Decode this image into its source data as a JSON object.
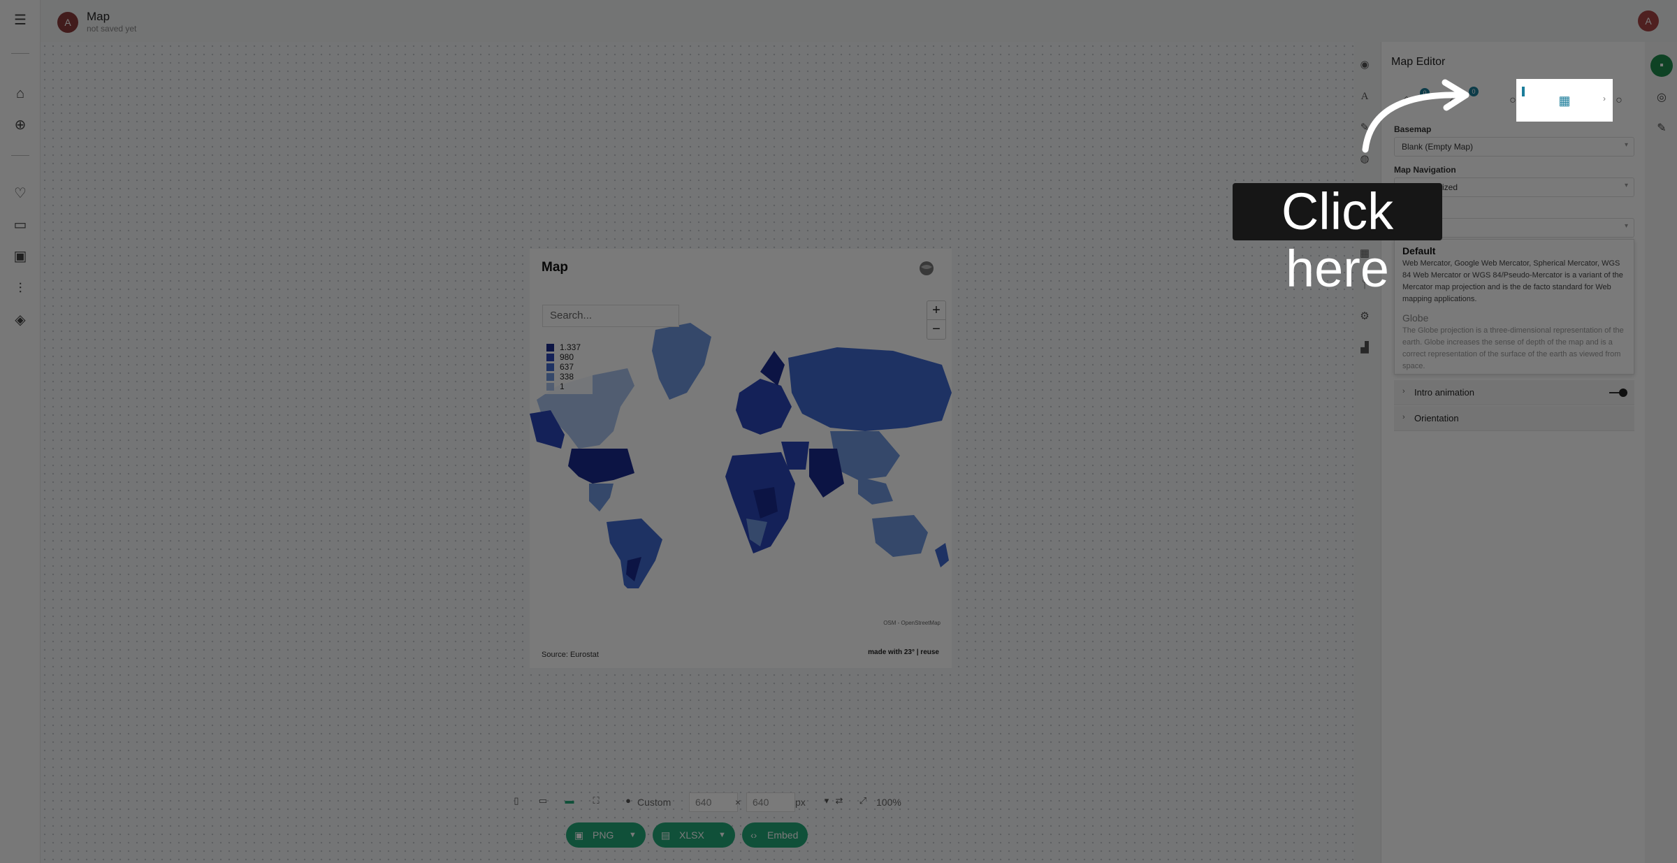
{
  "header": {
    "title": "Map",
    "subtitle": "not saved yet",
    "avatar_initial": "A",
    "right_avatar_initial": "A"
  },
  "leftbar": {
    "items": [
      "menu-icon",
      "home-icon",
      "add-icon",
      "heart-icon",
      "folder-icon",
      "image-icon",
      "sliders-icon",
      "layers-icon"
    ]
  },
  "map_card": {
    "title": "Map",
    "search_placeholder": "Search...",
    "zoom_in": "+",
    "zoom_out": "−",
    "legend": [
      {
        "label": "1.337",
        "color": "#1a2a8e"
      },
      {
        "label": "980",
        "color": "#2a46b8"
      },
      {
        "label": "637",
        "color": "#3f69cf"
      },
      {
        "label": "338",
        "color": "#6f97de"
      },
      {
        "label": "1",
        "color": "#a9c2ec"
      }
    ],
    "attribution": "OSM - OpenStreetMap",
    "source": "Source: Eurostat",
    "made_with": "made with 23° | reuse",
    "logo_text": "23°"
  },
  "bottom_toolbar": {
    "size_preset": "Custom",
    "width_value": "640",
    "height_value": "640",
    "unit": "px",
    "zoom": "100%",
    "separator": "×"
  },
  "export_buttons": [
    {
      "label": "PNG",
      "icon": "image-icon"
    },
    {
      "label": "XLSX",
      "icon": "table-icon"
    },
    {
      "label": "Embed",
      "icon": "code-icon"
    }
  ],
  "editor": {
    "title": "Map Editor",
    "tab_badges": [
      "0",
      "0"
    ],
    "basemap_label": "Basemap",
    "basemap_value": "Blank (Empty Map)",
    "navigation_label": "Map Navigation",
    "navigation_value": "Non-Optimized",
    "projection_options": [
      {
        "title": "Default",
        "description": "Web Mercator, Google Web Mercator, Spherical Mercator, WGS 84 Web Mercator or WGS 84/Pseudo-Mercator is a variant of the Mercator map projection and is the de facto standard for Web mapping applications."
      },
      {
        "title": "Globe",
        "description": "The Globe projection is a three-dimensional representation of the earth. Globe increases the sense of depth of the map and is a correct representation of the surface of the earth as viewed from space."
      }
    ],
    "accordions": [
      "Intro animation",
      "Orientation"
    ],
    "intro_animation_on": true
  },
  "tutorial": {
    "callout_text": "Click here"
  },
  "colors": {
    "accent_green": "#23a878",
    "badge_teal": "#1c7d9a",
    "save_green": "#1f8a4c"
  }
}
